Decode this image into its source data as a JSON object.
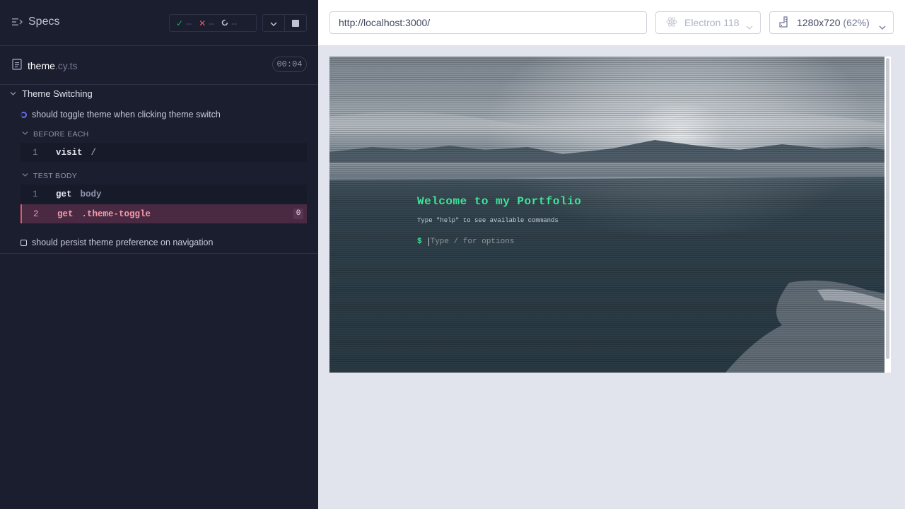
{
  "reporter": {
    "specs_label": "Specs",
    "stats": {
      "passed": "--",
      "failed": "--",
      "pending": "--"
    },
    "spec": {
      "name": "theme",
      "ext": ".cy.ts",
      "duration": "00:04"
    },
    "suite_title": "Theme Switching",
    "tests": [
      {
        "title": "should toggle theme when clicking theme switch"
      },
      {
        "title": "should persist theme preference on navigation"
      }
    ],
    "hooks": {
      "before_each": "BEFORE EACH",
      "test_body": "TEST BODY"
    },
    "commands": {
      "before_each": [
        {
          "num": "1",
          "name": "visit",
          "msg": "/"
        }
      ],
      "test_body": [
        {
          "num": "1",
          "name": "get",
          "msg": "body"
        },
        {
          "num": "2",
          "name": "get",
          "msg": ".theme-toggle",
          "count": "0"
        }
      ]
    },
    "colors": {
      "passed": "#1fa971",
      "failed": "#e45770",
      "running": "#6470f3"
    }
  },
  "aut": {
    "url": "http://localhost:3000/",
    "browser": "Electron 118",
    "viewport": {
      "size": "1280x720",
      "scale": "(62%)"
    },
    "app": {
      "heading": "Welcome to my Portfolio",
      "subtitle": "Type \"help\" to see available commands",
      "prompt_symbol": "$",
      "input_placeholder": "Type / for options"
    }
  }
}
